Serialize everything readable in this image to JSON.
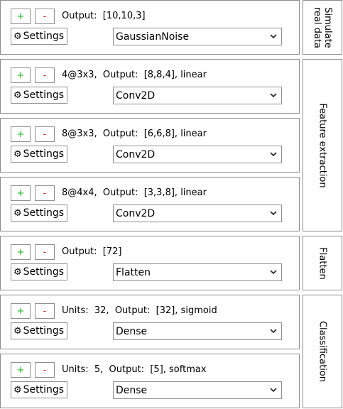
{
  "layers": [
    {
      "plus": "+",
      "minus": "-",
      "info": "Output:  [10,10,3]",
      "settings_label": "Settings",
      "selected": "GaussianNoise"
    },
    {
      "plus": "+",
      "minus": "-",
      "info": "4@3x3,  Output:  [8,8,4], linear",
      "settings_label": "Settings",
      "selected": "Conv2D"
    },
    {
      "plus": "+",
      "minus": "-",
      "info": "8@3x3,  Output:  [6,6,8], linear",
      "settings_label": "Settings",
      "selected": "Conv2D"
    },
    {
      "plus": "+",
      "minus": "-",
      "info": "8@4x4,  Output:  [3,3,8], linear",
      "settings_label": "Settings",
      "selected": "Conv2D"
    },
    {
      "plus": "+",
      "minus": "-",
      "info": "Output:  [72]",
      "settings_label": "Settings",
      "selected": "Flatten"
    },
    {
      "plus": "+",
      "minus": "-",
      "info": "Units:  32,  Output:  [32], sigmoid",
      "settings_label": "Settings",
      "selected": "Dense"
    },
    {
      "plus": "+",
      "minus": "-",
      "info": "Units:  5,  Output:  [5], softmax",
      "settings_label": "Settings",
      "selected": "Dense"
    }
  ],
  "groups": [
    {
      "label": "Simulate\nreal data"
    },
    {
      "label": "Feature extraction"
    },
    {
      "label": "Flatten"
    },
    {
      "label": "Classification"
    }
  ],
  "icons": {
    "settings": "gear-icon",
    "select": "chevron-down-icon"
  },
  "colors": {
    "plus": "#18b818",
    "minus": "#e02020",
    "border": "#8c8c8c"
  }
}
